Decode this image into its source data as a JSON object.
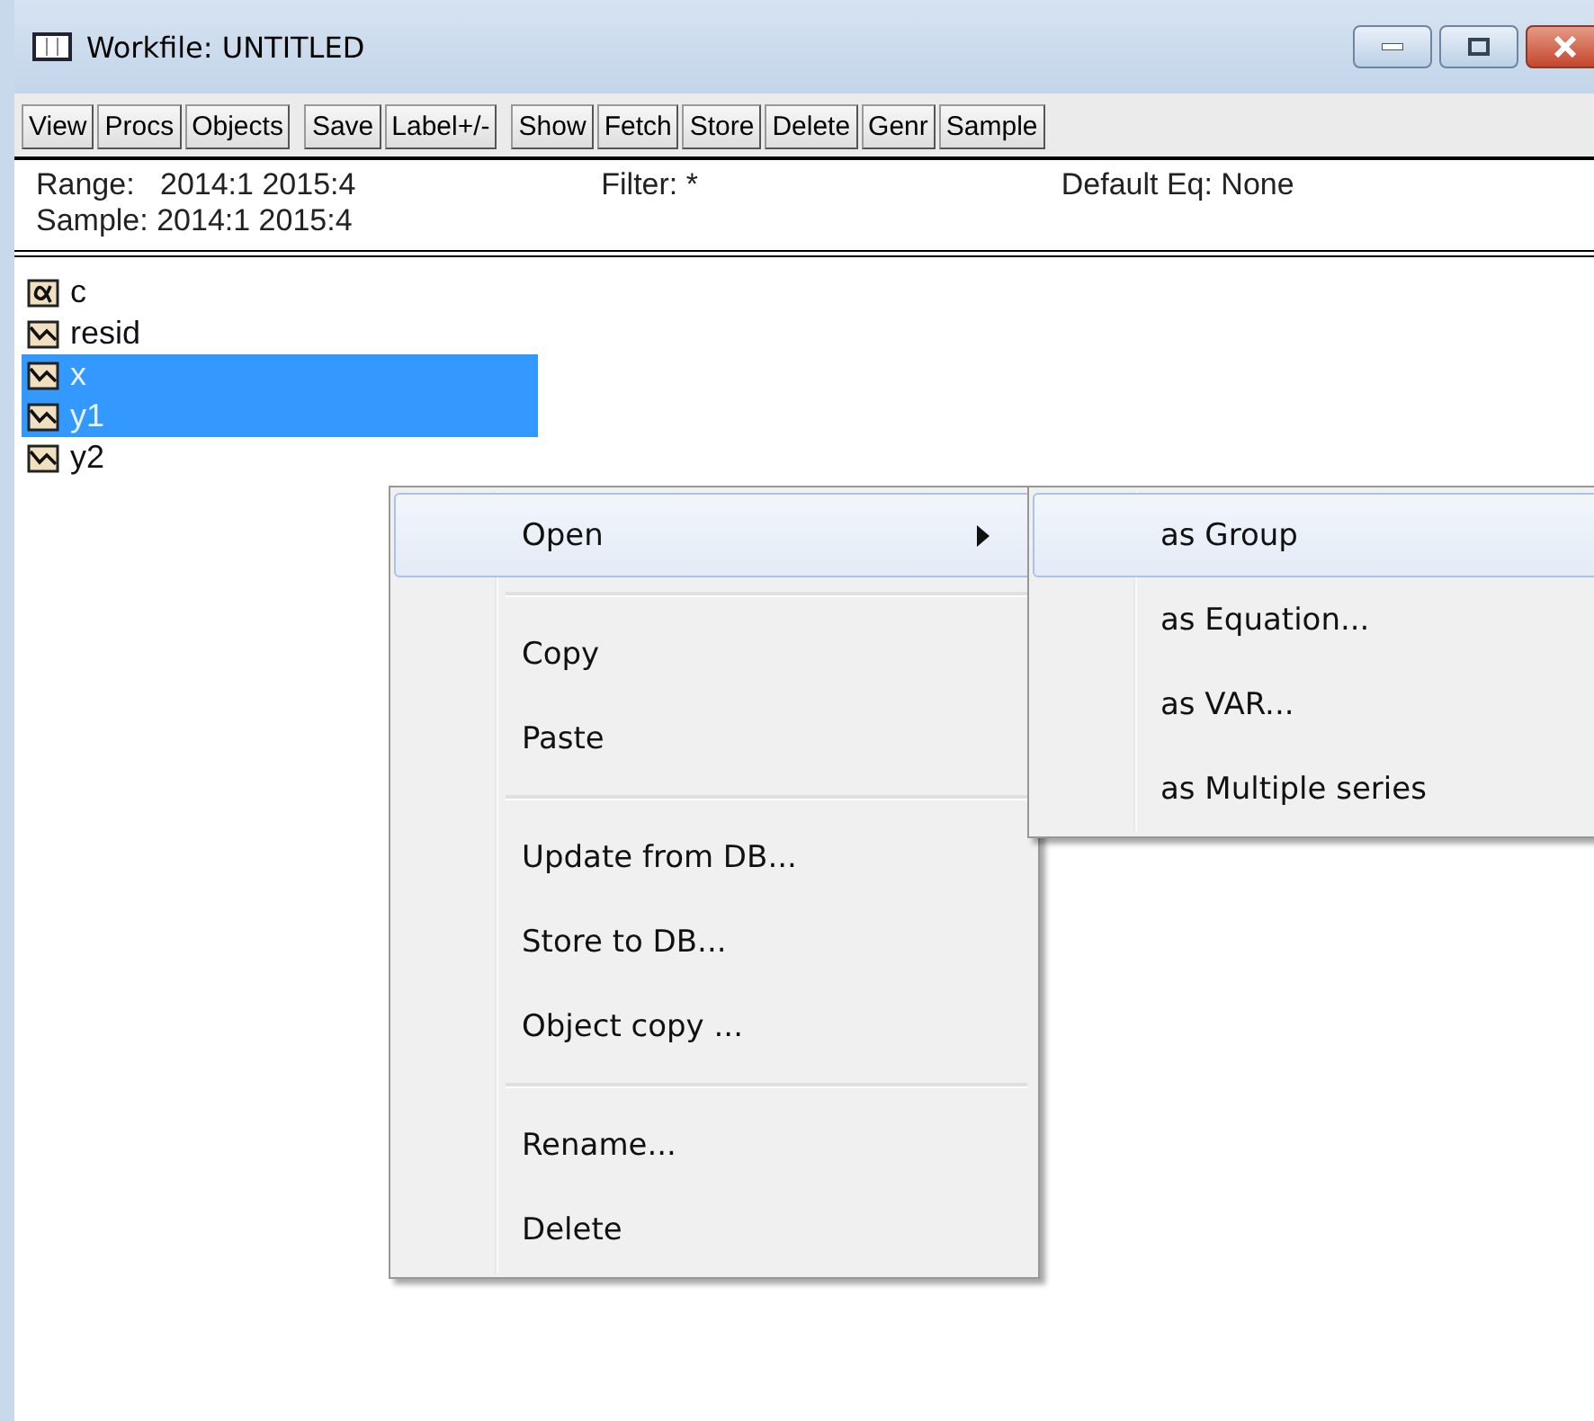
{
  "window": {
    "title": "Workfile: UNTITLED"
  },
  "toolbar": [
    [
      "View",
      "Procs",
      "Objects"
    ],
    [
      "Save",
      "Label+/-"
    ],
    [
      "Show",
      "Fetch",
      "Store",
      "Delete",
      "Genr",
      "Sample"
    ]
  ],
  "info": {
    "range": "Range:   2014:1 2015:4",
    "sample": "Sample: 2014:1 2015:4",
    "filter": "Filter: *",
    "default_eq": "Default Eq: None"
  },
  "objects": [
    {
      "kind": "coef",
      "name": "c",
      "selected": false
    },
    {
      "kind": "series",
      "name": "resid",
      "selected": false
    },
    {
      "kind": "series",
      "name": "x",
      "selected": true
    },
    {
      "kind": "series",
      "name": "y1",
      "selected": true
    },
    {
      "kind": "series",
      "name": "y2",
      "selected": false
    }
  ],
  "context_menu": [
    [
      {
        "label": "Open",
        "submenu": true,
        "selected": true
      }
    ],
    [
      {
        "label": "Copy",
        "submenu": false,
        "selected": false
      },
      {
        "label": "Paste",
        "submenu": false,
        "selected": false
      }
    ],
    [
      {
        "label": "Update from DB...",
        "submenu": false,
        "selected": false
      },
      {
        "label": "Store to DB...",
        "submenu": false,
        "selected": false
      },
      {
        "label": "Object copy ...",
        "submenu": false,
        "selected": false
      }
    ],
    [
      {
        "label": "Rename...",
        "submenu": false,
        "selected": false
      },
      {
        "label": "Delete",
        "submenu": false,
        "selected": false
      }
    ]
  ],
  "submenu": [
    {
      "label": "as Group",
      "selected": true
    },
    {
      "label": "as Equation...",
      "selected": false
    },
    {
      "label": "as VAR...",
      "selected": false
    },
    {
      "label": "as Multiple series",
      "selected": false
    }
  ]
}
